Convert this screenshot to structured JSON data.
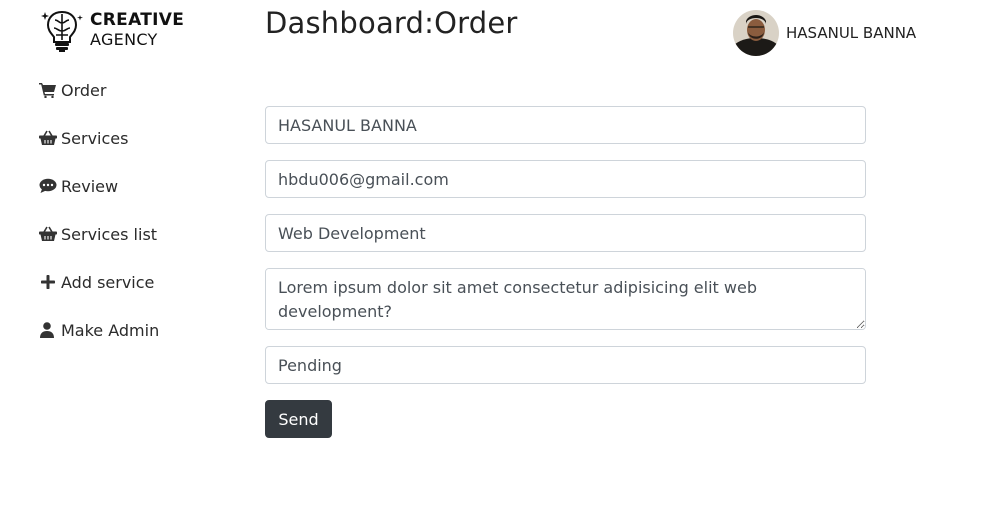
{
  "brand": {
    "line1": "CREATIVE",
    "line2": "AGENCY"
  },
  "sidebar": {
    "items": [
      {
        "label": "Order",
        "icon": "cart-icon"
      },
      {
        "label": "Services",
        "icon": "basket-icon"
      },
      {
        "label": "Review",
        "icon": "chat-icon"
      },
      {
        "label": "Services list",
        "icon": "basket-icon"
      },
      {
        "label": "Add service",
        "icon": "plus-icon"
      },
      {
        "label": "Make Admin",
        "icon": "user-icon"
      }
    ]
  },
  "header": {
    "title": "Dashboard:Order"
  },
  "user": {
    "name": "HASANUL BANNA"
  },
  "form": {
    "name": "HASANUL BANNA",
    "email": "hbdu006@gmail.com",
    "service": "Web Development",
    "description": "Lorem ipsum dolor sit amet consectetur adipisicing elit web development?",
    "status": "Pending",
    "submit_label": "Send"
  },
  "colors": {
    "button_bg": "#343a40",
    "input_border": "#ced4da",
    "text": "#495057"
  }
}
